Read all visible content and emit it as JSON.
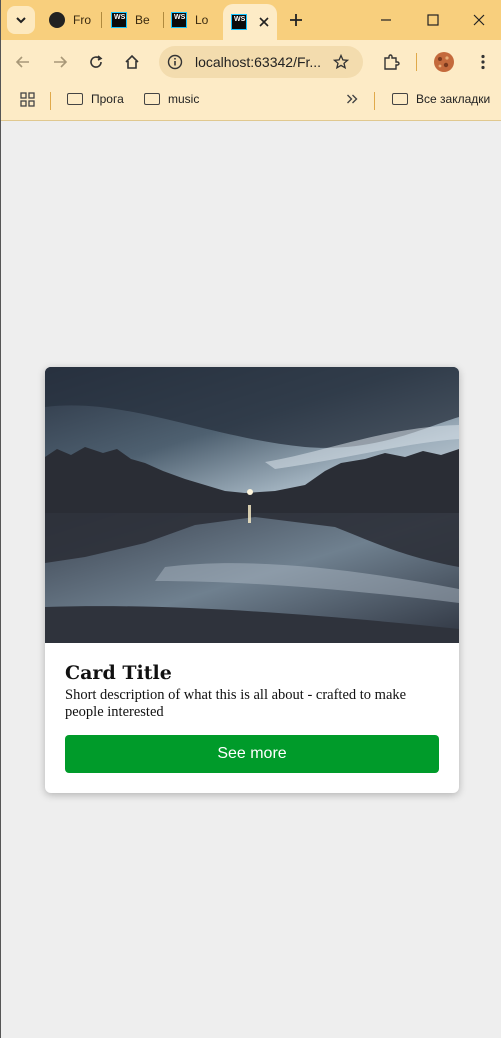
{
  "tabs": [
    {
      "label": "Fro",
      "icon": "github-icon"
    },
    {
      "label": "Ве",
      "icon": "webstorm-icon"
    },
    {
      "label": "Lo",
      "icon": "webstorm-icon"
    },
    {
      "label": "",
      "icon": "webstorm-icon",
      "active": true
    }
  ],
  "address": {
    "url": "localhost:63342/Fr..."
  },
  "bookmarks": {
    "items": [
      {
        "label": "Прога"
      },
      {
        "label": "music"
      }
    ],
    "all_label": "Все закладки"
  },
  "card": {
    "title": "Card Title",
    "description": "Short description of what this is all about - crafted to make people interested",
    "button_label": "See more"
  }
}
